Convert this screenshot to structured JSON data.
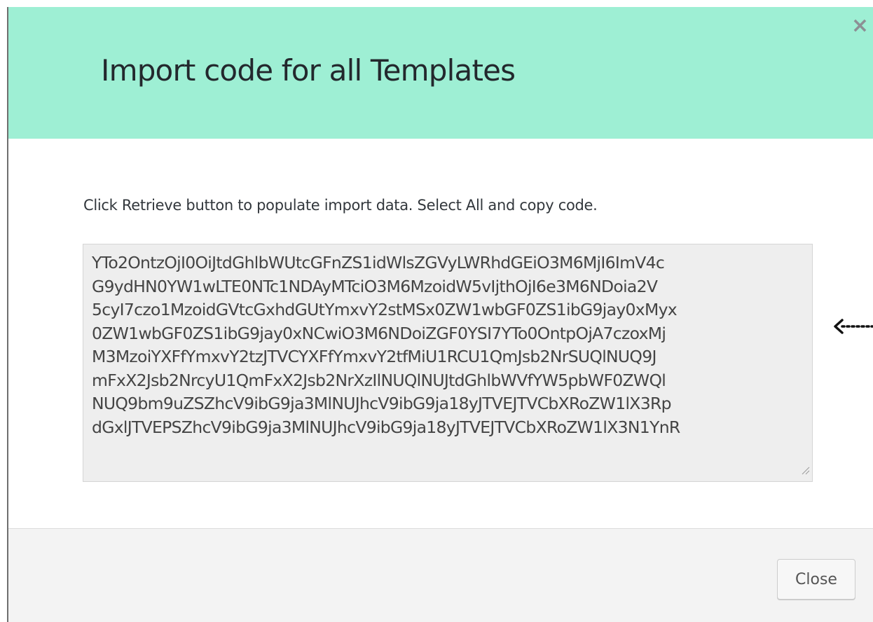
{
  "dialog": {
    "title": "Import code for all Templates",
    "close_icon_glyph": "×",
    "instruction": "Click Retrieve button to populate import data. Select All and copy code.",
    "import_code": "YTo2OntzOjI0OiJtdGhlbWUtcGFnZS1idWlsZGVyLWRhdGEiO3M6MjI6ImV4c\nG9ydHN0YW1wLTE0NTc1NDAyMTciO3M6MzoidW5vIjthOjI6e3M6NDoia2V\n5cyI7czo1MzoidGVtcGxhdGUtYmxvY2stMSx0ZW1wbGF0ZS1ibG9jay0xMyx\n0ZW1wbGF0ZS1ibG9jay0xNCwiO3M6NDoiZGF0YSI7YTo0OntpOjA7czoxMj\nM3MzoiYXFfYmxvY2tzJTVCYXFfYmxvY2tfMiU1RCU1QmJsb2NrSUQlNUQ9J\nmFxX2Jsb2NrcyU1QmFxX2Jsb2NrXzIlNUQlNUJtdGhlbWVfYW5pbWF0ZWQl\nNUQ9bm9uZSZhcV9ibG9ja3MlNUJhcV9ibG9ja18yJTVEJTVCbXRoZW1lX3Rp\ndGxlJTVEPSZhcV9ibG9ja3MlNUJhcV9ibG9ja18yJTVEJTVCbXRoZW1lX3N1YnR",
    "close_button_label": "Close"
  },
  "icons": {
    "close": "close-x-icon",
    "resize": "resize-grip-icon",
    "annotation": "dotted-arrow-left-icon"
  },
  "colors": {
    "header_background": "#9eefd4",
    "code_background": "#eeeeee",
    "footer_background": "#f3f3f3"
  }
}
